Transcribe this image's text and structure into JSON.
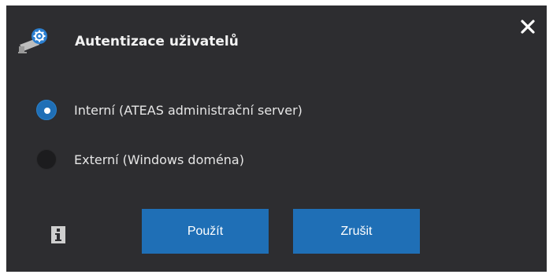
{
  "dialog": {
    "title": "Autentizace uživatelů",
    "title_icon": "camera-gear-icon",
    "close_icon": "close-icon"
  },
  "options": [
    {
      "label": "Interní (ATEAS administrační server)",
      "checked": true
    },
    {
      "label": "Externí (Windows doména)",
      "checked": false
    }
  ],
  "footer": {
    "info_icon": "info-icon",
    "apply_label": "Použít",
    "cancel_label": "Zrušit"
  },
  "colors": {
    "background": "#2d2d30",
    "accent": "#1f6fb6",
    "text": "#e6e6e6"
  }
}
